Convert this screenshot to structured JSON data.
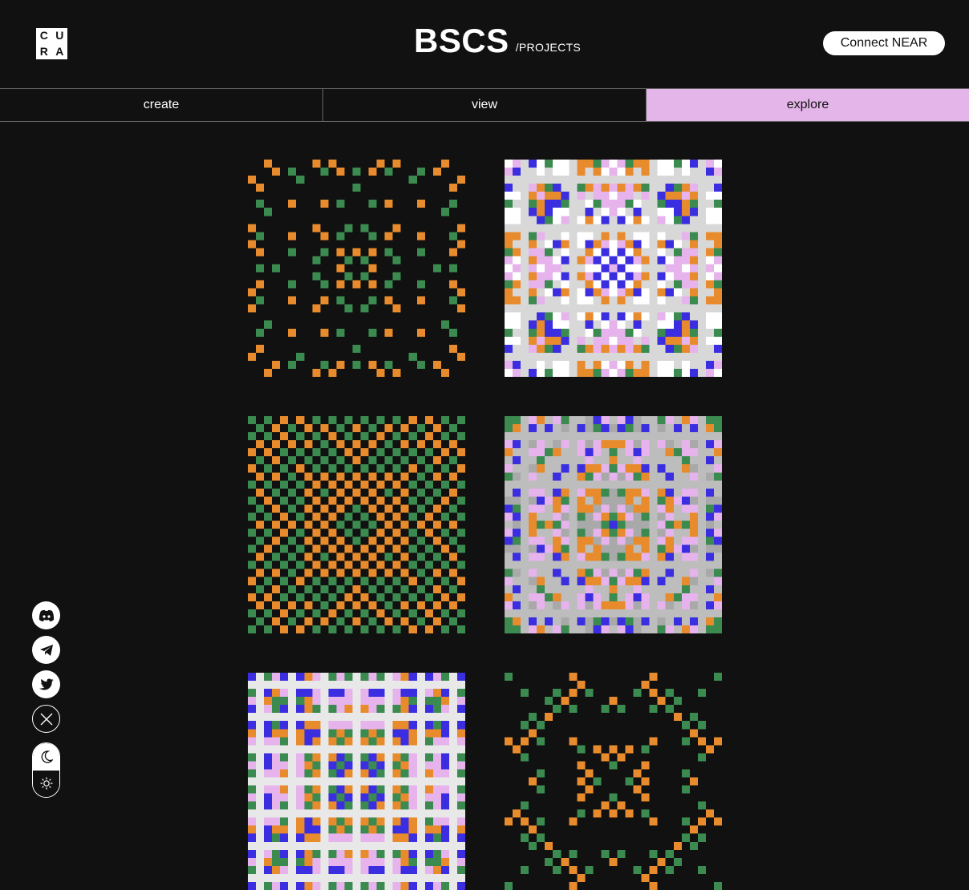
{
  "header": {
    "logo_letters": [
      "C",
      "U",
      "R",
      "A"
    ],
    "title": "BSCS",
    "subtitle": "/PROJECTS",
    "connect_label": "Connect NEAR"
  },
  "tabs": [
    {
      "label": "create",
      "active": false
    },
    {
      "label": "view",
      "active": false
    },
    {
      "label": "explore",
      "active": true
    }
  ],
  "gallery": {
    "items": [
      {
        "name": "artwork-1",
        "palette": [
          "#e88b2c",
          "#3b8a4f"
        ],
        "variant": "sparse",
        "bg": "#111111"
      },
      {
        "name": "artwork-2",
        "palette": [
          "#3a2ee0",
          "#e88b2c",
          "#3b8a4f",
          "#e6b3ec",
          "#d8d8d8"
        ],
        "variant": "dense",
        "bg": "#ffffff"
      },
      {
        "name": "artwork-3",
        "palette": [
          "#e88b2c",
          "#3b8a4f"
        ],
        "variant": "checker",
        "bg": "#111111"
      },
      {
        "name": "artwork-4",
        "palette": [
          "#3a2ee0",
          "#e88b2c",
          "#3b8a4f",
          "#e6b3ec",
          "#bdbdbd"
        ],
        "variant": "dense",
        "bg": "#a9a9a9"
      },
      {
        "name": "artwork-5",
        "palette": [
          "#3a2ee0",
          "#e88b2c",
          "#3b8a4f",
          "#e6b3ec"
        ],
        "variant": "light",
        "bg": "#e8e8e8"
      },
      {
        "name": "artwork-6",
        "palette": [
          "#3b8a4f",
          "#e88b2c"
        ],
        "variant": "sparse",
        "bg": "#111111"
      }
    ]
  },
  "sidebar": {
    "icons": [
      "discord-icon",
      "telegram-icon",
      "twitter-icon",
      "close-x-icon"
    ],
    "theme": {
      "moon_icon": "moon-icon",
      "sun_icon": "sun-icon"
    }
  },
  "colors": {
    "background": "#111111",
    "accent_tab": "#e4b5e8",
    "orange": "#e88b2c",
    "green": "#3b8a4f",
    "blue": "#3a2ee0",
    "pink": "#e6b3ec"
  }
}
